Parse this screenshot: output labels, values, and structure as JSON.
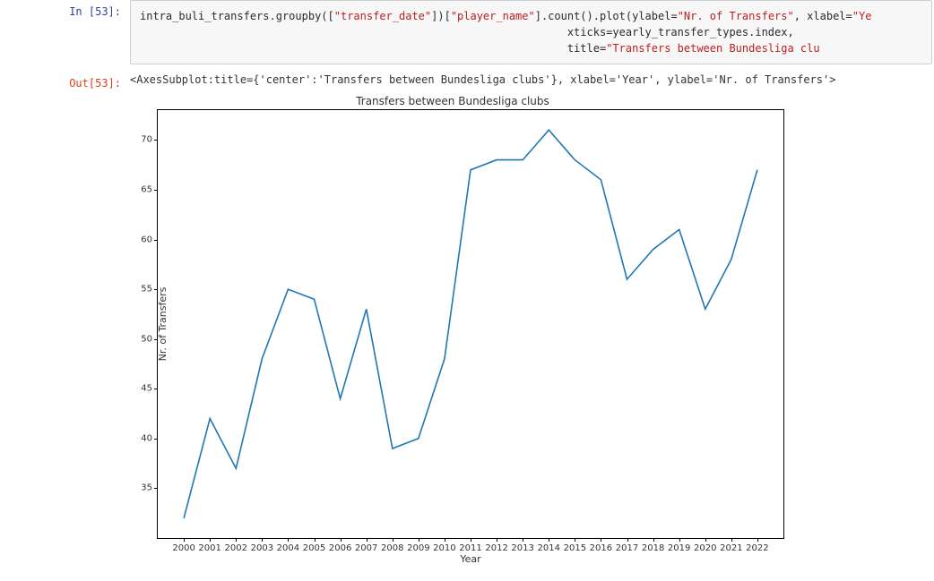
{
  "input_prompt": "In [53]:",
  "output_prompt": "Out[53]:",
  "code": {
    "line1_pre": "intra_buli_transfers.groupby([",
    "line1_str1": "\"transfer_date\"",
    "line1_mid1": "])[",
    "line1_str2": "\"player_name\"",
    "line1_mid2": "].count().plot(ylabel=",
    "line1_str3": "\"Nr. of Transfers\"",
    "line1_mid3": ", xlabel=",
    "line1_str4": "\"Ye",
    "indent2": "                                                                  ",
    "line2_kw": "xticks=",
    "line2_val": "yearly_transfer_types.index,",
    "indent3": "                                                                  ",
    "line3_kw": "title=",
    "line3_str": "\"Transfers between Bundesliga clu"
  },
  "output_repr": "<AxesSubplot:title={'center':'Transfers between Bundesliga clubs'}, xlabel='Year', ylabel='Nr. of Transfers'>",
  "chart_data": {
    "type": "line",
    "title": "Transfers between Bundesliga clubs",
    "xlabel": "Year",
    "ylabel": "Nr. of Transfers",
    "categories": [
      2000,
      2001,
      2002,
      2003,
      2004,
      2005,
      2006,
      2007,
      2008,
      2009,
      2010,
      2011,
      2012,
      2013,
      2014,
      2015,
      2016,
      2017,
      2018,
      2019,
      2020,
      2021,
      2022
    ],
    "values": [
      32,
      42,
      37,
      48,
      55,
      54,
      44,
      53,
      39,
      40,
      48,
      67,
      68,
      68,
      71,
      68,
      66,
      56,
      59,
      61,
      53,
      58,
      67
    ],
    "yticks": [
      35,
      40,
      45,
      50,
      55,
      60,
      65,
      70
    ],
    "xlim": [
      1999,
      2023
    ],
    "ylim": [
      30,
      73
    ],
    "line_color": "#1f77b4"
  }
}
